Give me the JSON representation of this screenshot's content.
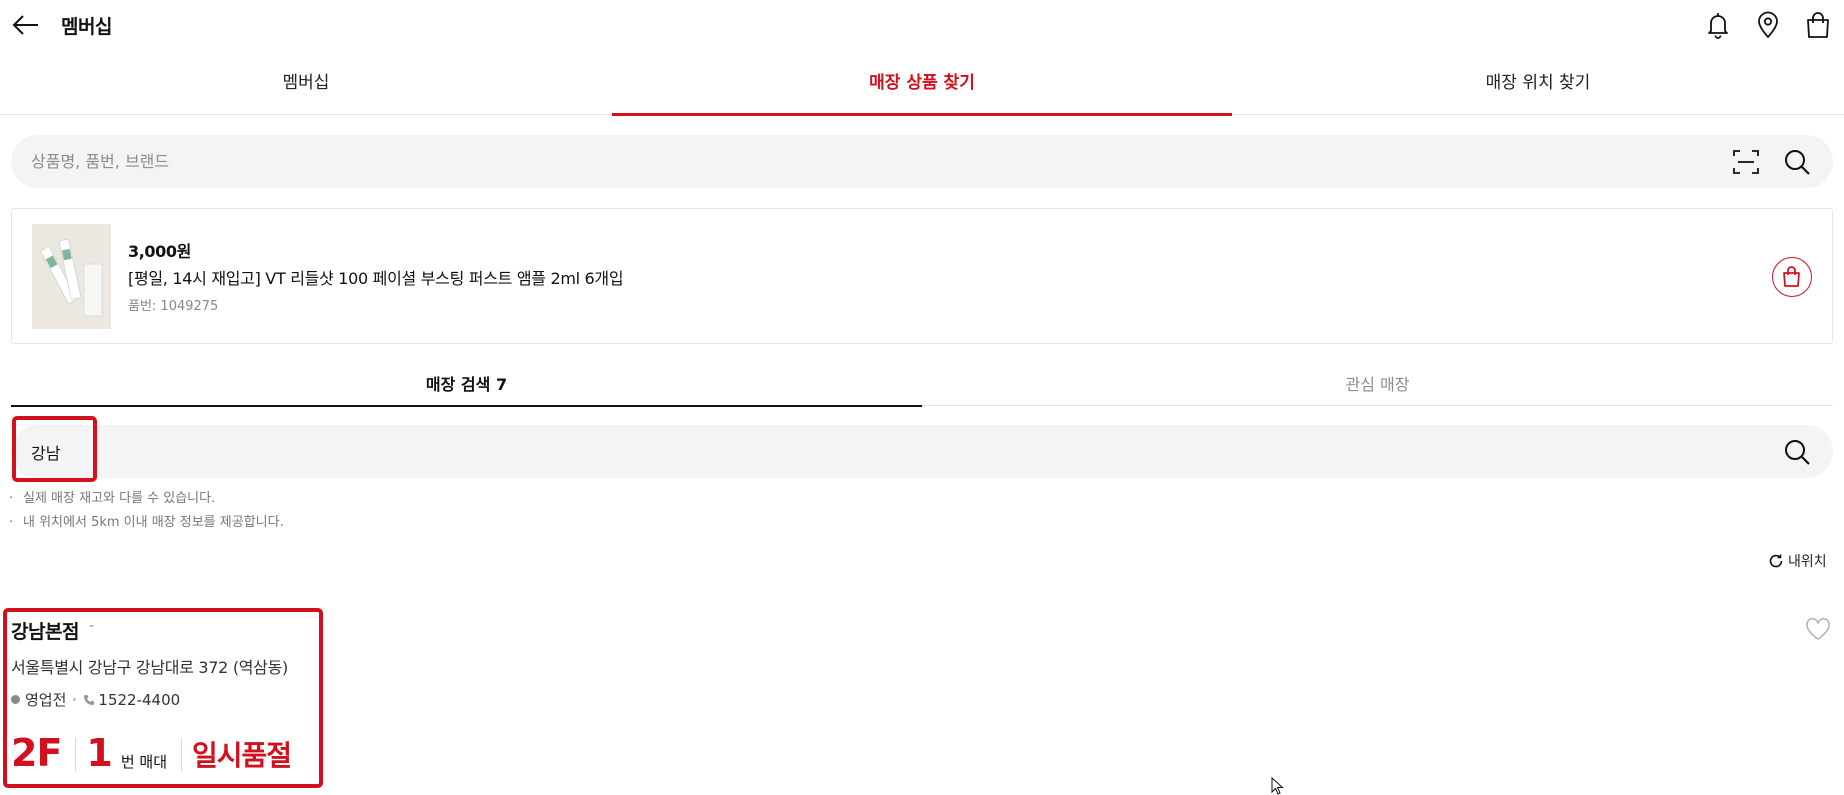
{
  "header": {
    "title": "멤버십",
    "icons": [
      "back-arrow-icon",
      "bell-icon",
      "location-pin-icon",
      "shopping-bag-icon"
    ]
  },
  "main_tabs": [
    {
      "label": "멤버십",
      "active": false
    },
    {
      "label": "매장 상품 찾기",
      "active": true
    },
    {
      "label": "매장 위치 찾기",
      "active": false
    }
  ],
  "product_search": {
    "placeholder": "상품명, 품번, 브랜드",
    "value": ""
  },
  "product": {
    "price": "3,000원",
    "name": "[평일, 14시 재입고] VT 리들샷 100 페이셜 부스팅 퍼스트 앰플 2ml 6개입",
    "code": "품번: 1049275"
  },
  "store_tabs": [
    {
      "label": "매장 검색 7",
      "active": true
    },
    {
      "label": "관심 매장",
      "active": false
    }
  ],
  "store_search": {
    "value": "강남",
    "placeholder": ""
  },
  "notes": [
    "실제 매장 재고와 다를 수 있습니다.",
    "내 위치에서 5km 이내 매장 정보를 제공합니다."
  ],
  "my_location_label": "내위치",
  "store": {
    "name": "강남본점",
    "distance": "-",
    "address": "서울특별시 강남구 강남대로 372 (역삼동)",
    "status": "영업전",
    "phone": "1522-4400",
    "floor": "2F",
    "shelf_number": "1",
    "shelf_label": "번 매대",
    "stock_status": "일시품절"
  },
  "colors": {
    "accent": "#d3101e",
    "search_bg": "#f4f4f4",
    "muted_text": "#888888"
  }
}
